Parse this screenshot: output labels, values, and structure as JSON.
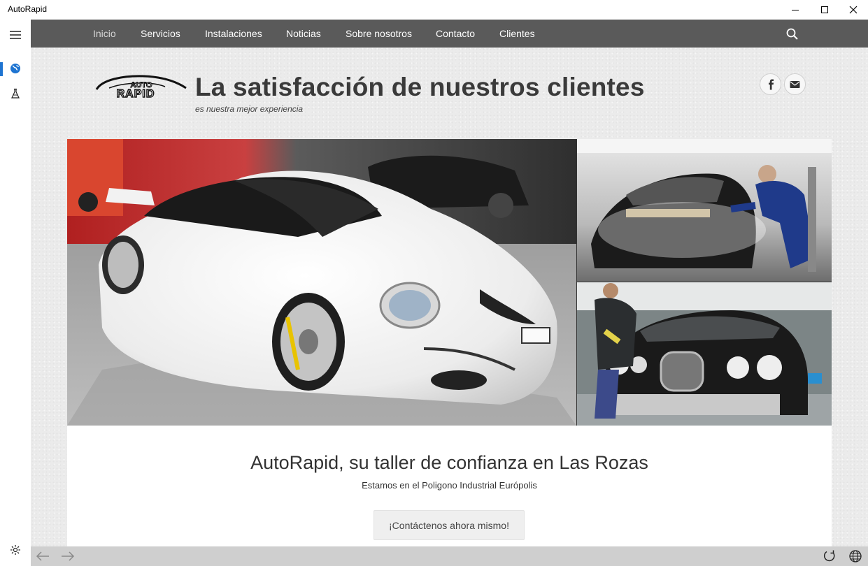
{
  "window": {
    "title": "AutoRapid"
  },
  "rail": {
    "items": [
      {
        "icon": "hamburger-menu-icon"
      },
      {
        "icon": "globe-icon",
        "active": true
      },
      {
        "icon": "flask-icon"
      }
    ],
    "settings_icon": "gear-icon"
  },
  "nav": {
    "items": [
      {
        "label": "Inicio",
        "active": true
      },
      {
        "label": "Servicios"
      },
      {
        "label": "Instalaciones"
      },
      {
        "label": "Noticias"
      },
      {
        "label": "Sobre nosotros"
      },
      {
        "label": "Contacto"
      },
      {
        "label": "Clientes"
      }
    ],
    "search_icon": "search-icon"
  },
  "header": {
    "logo_top": "AUTO",
    "logo_bottom": "RAPID",
    "headline": "La satisfacción de nuestros clientes",
    "tagline": "es nuestra mejor experiencia",
    "social": [
      "facebook-icon",
      "mail-icon"
    ]
  },
  "hero": {
    "photos": [
      "white-sports-car-photo",
      "car-painting-booth-photo",
      "mechanic-with-jaguar-photo"
    ]
  },
  "intro": {
    "title": "AutoRapid, su taller de confianza en Las Rozas",
    "subtitle": "Estamos en el Poligono Industrial Európolis",
    "cta_label": "¡Contáctenos ahora mismo!"
  },
  "colors": {
    "navbar": "#5a5a5a",
    "accent": "#1e74d1",
    "bottombar": "#cfcfcf"
  }
}
